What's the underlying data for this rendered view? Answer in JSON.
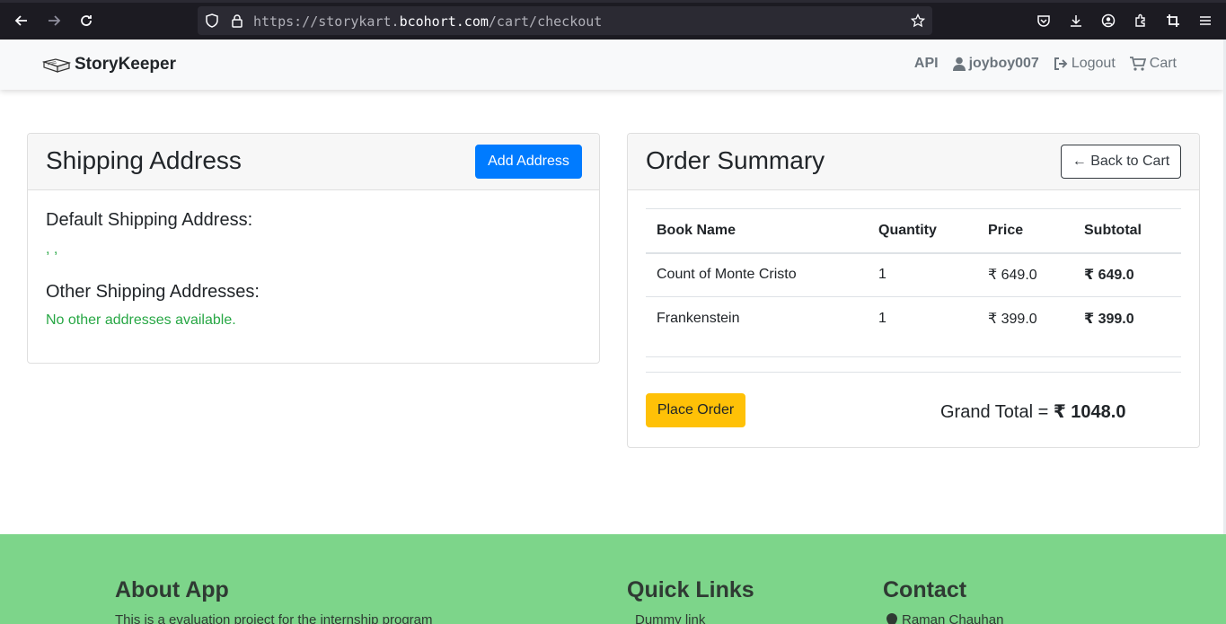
{
  "browser": {
    "url_prefix": "https://storykart.",
    "url_host": "bcohort.com",
    "url_path": "/cart/checkout"
  },
  "navbar": {
    "brand": "StoryKeeper",
    "api": "API",
    "username": "joyboy007",
    "logout": "Logout",
    "cart": "Cart"
  },
  "shipping": {
    "title": "Shipping Address",
    "add_button": "Add Address",
    "default_heading": "Default Shipping Address:",
    "default_value": ", ,",
    "other_heading": "Other Shipping Addresses:",
    "other_value": "No other addresses available."
  },
  "order": {
    "title": "Order Summary",
    "back_button": "← Back to Cart",
    "columns": [
      "Book Name",
      "Quantity",
      "Price",
      "Subtotal"
    ],
    "rows": [
      {
        "name": "Count of Monte Cristo",
        "qty": "1",
        "price": "₹ 649.0",
        "subtotal": "₹ 649.0"
      },
      {
        "name": "Frankenstein",
        "qty": "1",
        "price": "₹ 399.0",
        "subtotal": "₹ 399.0"
      }
    ],
    "place_order": "Place Order",
    "grand_total_label": "Grand Total = ",
    "grand_total_value": "₹ 1048.0"
  },
  "footer": {
    "about_heading": "About App",
    "about_text": "This is a evaluation project for the internship program",
    "links_heading": "Quick Links",
    "link1": "Dummy link",
    "contact_heading": "Contact",
    "contact_name": "Raman Chauhan"
  },
  "colors": {
    "primary": "#007bff",
    "warning": "#ffc107",
    "success": "#28a745",
    "footer_bg": "#7dd58a"
  }
}
